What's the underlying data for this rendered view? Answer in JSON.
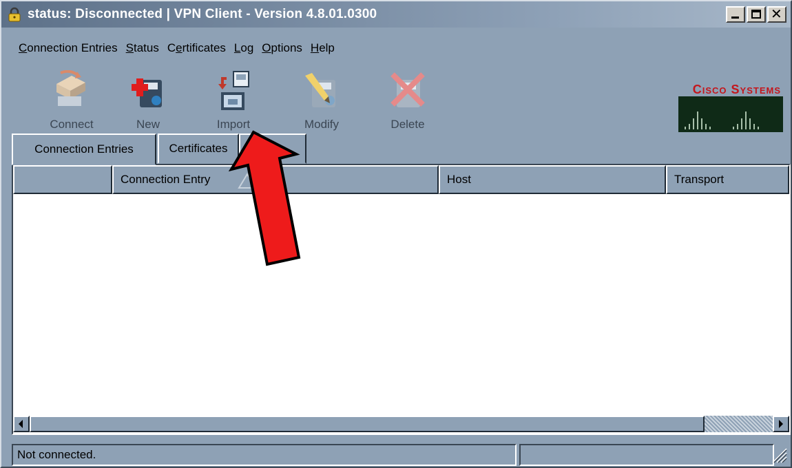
{
  "window": {
    "title": "status: Disconnected | VPN Client - Version 4.8.01.0300"
  },
  "menu": [
    {
      "label": "Connection Entries",
      "key": "C"
    },
    {
      "label": "Status",
      "key": "S"
    },
    {
      "label": "Certificates",
      "key": "e"
    },
    {
      "label": "Log",
      "key": "L"
    },
    {
      "label": "Options",
      "key": "O"
    },
    {
      "label": "Help",
      "key": "H"
    }
  ],
  "toolbar": {
    "connect": "Connect",
    "new": "New",
    "import": "Import",
    "modify": "Modify",
    "delete": "Delete"
  },
  "brand": {
    "name": "Cisco Systems",
    "color": "#c4161c"
  },
  "tabs": [
    "Connection Entries",
    "Certificates",
    "Log"
  ],
  "table": {
    "columns": [
      "",
      "Connection Entry",
      "Host",
      "Transport"
    ],
    "rows": []
  },
  "status": {
    "text": "Not connected.",
    "secondary": ""
  }
}
